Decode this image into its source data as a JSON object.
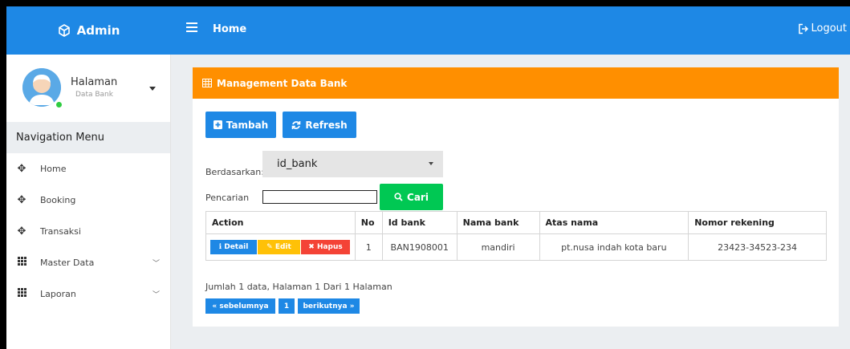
{
  "topbar": {
    "brand": "Admin",
    "title": "Home",
    "logout_label": "Logout"
  },
  "sidebar": {
    "profile_name": "Halaman",
    "profile_sub": "Data Bank",
    "nav_header": "Navigation Menu",
    "items": [
      {
        "label": "Home",
        "icon": "arrows-move-icon"
      },
      {
        "label": "Booking",
        "icon": "arrows-move-icon"
      },
      {
        "label": "Transaksi",
        "icon": "arrows-move-icon"
      },
      {
        "label": "Master Data",
        "icon": "grid-icon"
      },
      {
        "label": "Laporan",
        "icon": "grid-icon"
      }
    ]
  },
  "main": {
    "card_title": "Management Data Bank",
    "tambah_label": "Tambah",
    "refresh_label": "Refresh",
    "berdasarkan_label": "Berdasarkan:",
    "select_value": "id_bank",
    "pencarian_label": "Pencarian",
    "search_value": "",
    "cari_label": "Cari",
    "table": {
      "headers": [
        "Action",
        "No",
        "Id bank",
        "Nama bank",
        "Atas nama",
        "Nomor rekening"
      ],
      "rows": [
        {
          "no": "1",
          "id_bank": "BAN1908001",
          "nama_bank": "mandiri",
          "atas_nama": "pt.nusa indah kota baru",
          "nomor_rekening": "23423-34523-234"
        }
      ],
      "detail_label": "Detail",
      "edit_label": "Edit",
      "hapus_label": "Hapus"
    },
    "info_text": "Jumlah 1 data, Halaman 1 Dari 1 Halaman",
    "pager": {
      "prev": "« sebelumnya",
      "page": "1",
      "next": "berikutnya »"
    }
  },
  "colors": {
    "topbar": "#1e88e5",
    "card_header": "#ff8f00",
    "primary": "#1e88e5",
    "success": "#00c853",
    "warning": "#ffc107",
    "danger": "#f44336"
  }
}
